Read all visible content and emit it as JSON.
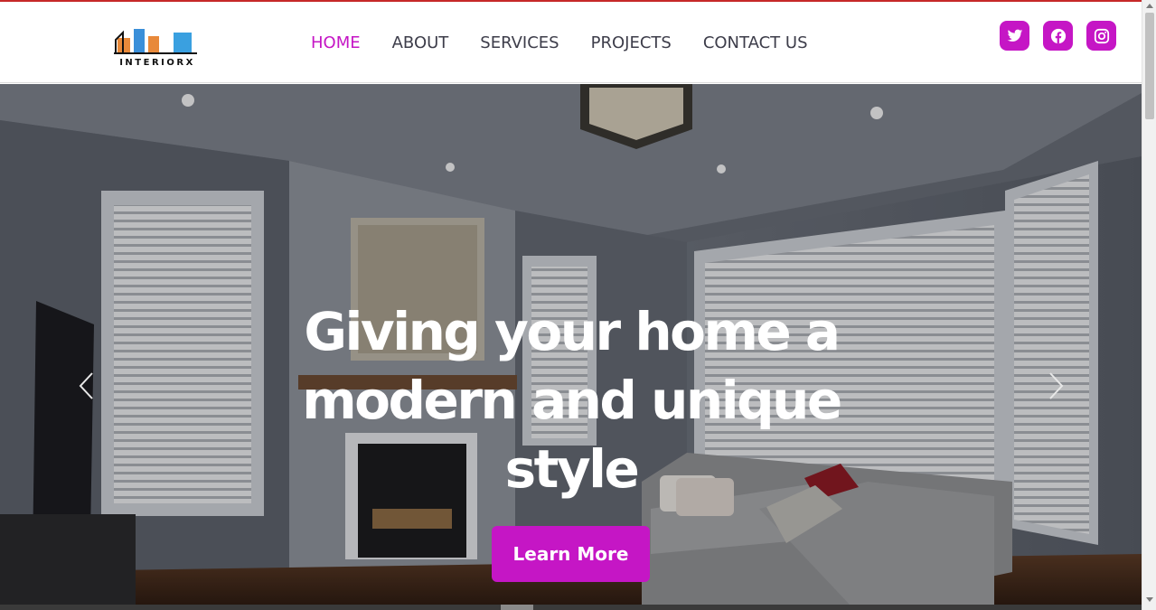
{
  "brand": {
    "name": "INTERIORX",
    "colors": {
      "accent": "#c516c5",
      "top_border": "#c62828",
      "nav_text": "#3d3d4a"
    }
  },
  "nav": {
    "items": [
      {
        "label": "HOME",
        "active": true
      },
      {
        "label": "ABOUT",
        "active": false
      },
      {
        "label": "SERVICES",
        "active": false
      },
      {
        "label": "PROJECTS",
        "active": false
      },
      {
        "label": "CONTACT US",
        "active": false
      }
    ]
  },
  "social": [
    {
      "icon": "twitter-icon"
    },
    {
      "icon": "facebook-icon"
    },
    {
      "icon": "instagram-icon"
    }
  ],
  "hero": {
    "headline": "Giving your home a modern and unique style",
    "cta_label": "Learn More",
    "image": "living-room-photo",
    "prev_icon": "chevron-left-icon",
    "next_icon": "chevron-right-icon"
  }
}
